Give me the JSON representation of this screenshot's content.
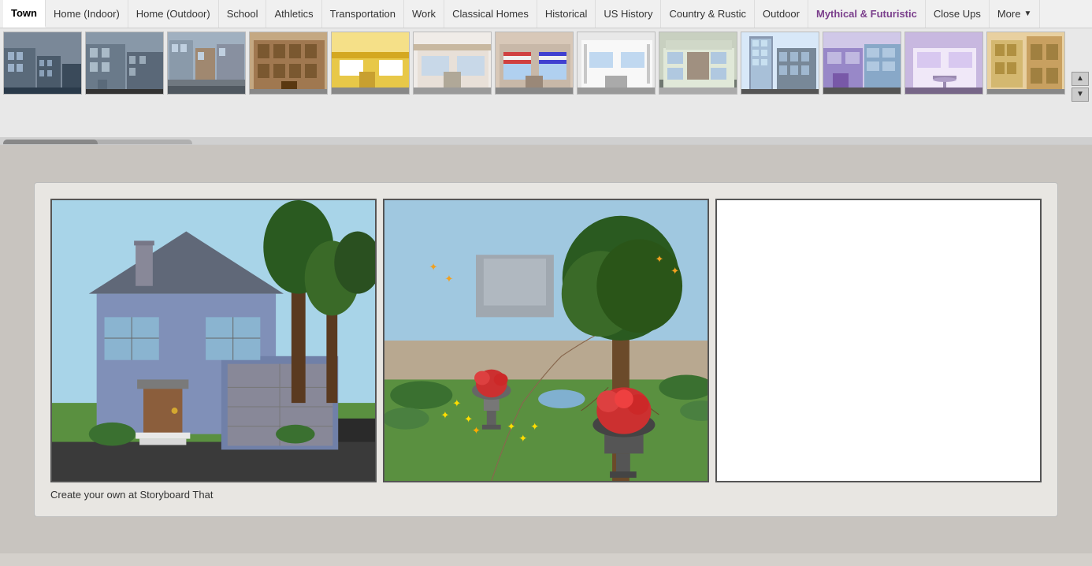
{
  "nav": {
    "items": [
      {
        "id": "town",
        "label": "Town",
        "active": true,
        "mythical": false
      },
      {
        "id": "home-indoor",
        "label": "Home (Indoor)",
        "active": false,
        "mythical": false
      },
      {
        "id": "home-outdoor",
        "label": "Home (Outdoor)",
        "active": false,
        "mythical": false
      },
      {
        "id": "school",
        "label": "School",
        "active": false,
        "mythical": false
      },
      {
        "id": "athletics",
        "label": "Athletics",
        "active": false,
        "mythical": false
      },
      {
        "id": "transportation",
        "label": "Transportation",
        "active": false,
        "mythical": false
      },
      {
        "id": "work",
        "label": "Work",
        "active": false,
        "mythical": false
      },
      {
        "id": "classical-homes",
        "label": "Classical Homes",
        "active": false,
        "mythical": false
      },
      {
        "id": "historical",
        "label": "Historical",
        "active": false,
        "mythical": false
      },
      {
        "id": "us-history",
        "label": "US History",
        "active": false,
        "mythical": false
      },
      {
        "id": "country-rustic",
        "label": "Country & Rustic",
        "active": false,
        "mythical": false
      },
      {
        "id": "outdoor",
        "label": "Outdoor",
        "active": false,
        "mythical": false
      },
      {
        "id": "mythical-futuristic",
        "label": "Mythical & Futuristic",
        "active": false,
        "mythical": true
      },
      {
        "id": "close-ups",
        "label": "Close Ups",
        "active": false,
        "mythical": false
      },
      {
        "id": "more",
        "label": "More",
        "active": false,
        "mythical": false
      }
    ]
  },
  "scroll_controls": {
    "up_label": "▲",
    "down_label": "▼"
  },
  "caption": {
    "text": "Create your own at Storyboard That"
  },
  "thumbnails": [
    {
      "id": 1,
      "cls": "thumb-1"
    },
    {
      "id": 2,
      "cls": "thumb-2"
    },
    {
      "id": 3,
      "cls": "thumb-3"
    },
    {
      "id": 4,
      "cls": "thumb-4"
    },
    {
      "id": 5,
      "cls": "thumb-5"
    },
    {
      "id": 6,
      "cls": "thumb-6"
    },
    {
      "id": 7,
      "cls": "thumb-7"
    },
    {
      "id": 8,
      "cls": "thumb-8"
    },
    {
      "id": 9,
      "cls": "thumb-9"
    },
    {
      "id": 10,
      "cls": "thumb-10"
    },
    {
      "id": 11,
      "cls": "thumb-11"
    },
    {
      "id": 12,
      "cls": "thumb-12"
    },
    {
      "id": 13,
      "cls": "thumb-13"
    }
  ]
}
